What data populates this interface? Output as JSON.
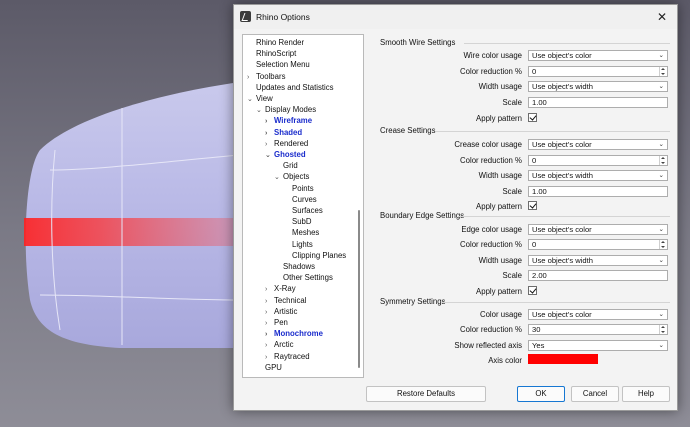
{
  "window": {
    "title": "Rhino Options",
    "close_glyph": "✕"
  },
  "tree": {
    "items": [
      {
        "label": "Rhino Render",
        "level": 0,
        "chev": "",
        "bold": false
      },
      {
        "label": "RhinoScript",
        "level": 0,
        "chev": "",
        "bold": false
      },
      {
        "label": "Selection Menu",
        "level": 0,
        "chev": "",
        "bold": false
      },
      {
        "label": "Toolbars",
        "level": 0,
        "chev": "›",
        "bold": false
      },
      {
        "label": "Updates and Statistics",
        "level": 0,
        "chev": "",
        "bold": false
      },
      {
        "label": "View",
        "level": 0,
        "chev": "⌄",
        "bold": false
      },
      {
        "label": "Display Modes",
        "level": 1,
        "chev": "⌄",
        "bold": false
      },
      {
        "label": "Wireframe",
        "level": 2,
        "chev": "›",
        "bold": true
      },
      {
        "label": "Shaded",
        "level": 2,
        "chev": "›",
        "bold": true
      },
      {
        "label": "Rendered",
        "level": 2,
        "chev": "›",
        "bold": false
      },
      {
        "label": "Ghosted",
        "level": 2,
        "chev": "⌄",
        "bold": true
      },
      {
        "label": "Grid",
        "level": 3,
        "chev": "",
        "bold": false
      },
      {
        "label": "Objects",
        "level": 3,
        "chev": "⌄",
        "bold": false
      },
      {
        "label": "Points",
        "level": 4,
        "chev": "",
        "bold": false
      },
      {
        "label": "Curves",
        "level": 4,
        "chev": "",
        "bold": false
      },
      {
        "label": "Surfaces",
        "level": 4,
        "chev": "",
        "bold": false
      },
      {
        "label": "SubD",
        "level": 4,
        "chev": "",
        "bold": false
      },
      {
        "label": "Meshes",
        "level": 4,
        "chev": "",
        "bold": false
      },
      {
        "label": "Lights",
        "level": 4,
        "chev": "",
        "bold": false
      },
      {
        "label": "Clipping Planes",
        "level": 4,
        "chev": "",
        "bold": false
      },
      {
        "label": "Shadows",
        "level": 3,
        "chev": "",
        "bold": false
      },
      {
        "label": "Other Settings",
        "level": 3,
        "chev": "",
        "bold": false
      },
      {
        "label": "X-Ray",
        "level": 2,
        "chev": "›",
        "bold": false
      },
      {
        "label": "Technical",
        "level": 2,
        "chev": "›",
        "bold": false
      },
      {
        "label": "Artistic",
        "level": 2,
        "chev": "›",
        "bold": false
      },
      {
        "label": "Pen",
        "level": 2,
        "chev": "›",
        "bold": false
      },
      {
        "label": "Monochrome",
        "level": 2,
        "chev": "›",
        "bold": true
      },
      {
        "label": "Arctic",
        "level": 2,
        "chev": "›",
        "bold": false
      },
      {
        "label": "Raytraced",
        "level": 2,
        "chev": "›",
        "bold": false
      },
      {
        "label": "GPU",
        "level": 1,
        "chev": "",
        "bold": false
      }
    ],
    "selected": "SubD"
  },
  "smooth_wire": {
    "title": "Smooth Wire Settings",
    "wire_color_usage": {
      "label": "Wire color usage",
      "value": "Use object's color"
    },
    "color_reduction": {
      "label": "Color reduction %",
      "value": "0"
    },
    "width_usage": {
      "label": "Width usage",
      "value": "Use object's width"
    },
    "scale": {
      "label": "Scale",
      "value": "1.00"
    },
    "apply_pattern": {
      "label": "Apply pattern",
      "checked": true
    }
  },
  "crease": {
    "title": "Crease Settings",
    "crease_color_usage": {
      "label": "Crease color usage",
      "value": "Use object's color"
    },
    "color_reduction": {
      "label": "Color reduction %",
      "value": "0"
    },
    "width_usage": {
      "label": "Width usage",
      "value": "Use object's width"
    },
    "scale": {
      "label": "Scale",
      "value": "1.00"
    },
    "apply_pattern": {
      "label": "Apply pattern",
      "checked": true
    }
  },
  "boundary": {
    "title": "Boundary Edge Settings",
    "edge_color_usage": {
      "label": "Edge color usage",
      "value": "Use object's color"
    },
    "color_reduction": {
      "label": "Color reduction %",
      "value": "0"
    },
    "width_usage": {
      "label": "Width usage",
      "value": "Use object's width"
    },
    "scale": {
      "label": "Scale",
      "value": "2.00"
    },
    "apply_pattern": {
      "label": "Apply pattern",
      "checked": true
    }
  },
  "symmetry": {
    "title": "Symmetry Settings",
    "color_usage": {
      "label": "Color usage",
      "value": "Use object's color"
    },
    "color_reduction": {
      "label": "Color reduction %",
      "value": "30"
    },
    "show_reflected_axis": {
      "label": "Show reflected axis",
      "value": "Yes"
    },
    "axis_color": {
      "label": "Axis color",
      "color": "#ff0000"
    }
  },
  "buttons": {
    "restore": "Restore Defaults",
    "ok": "OK",
    "cancel": "Cancel",
    "help": "Help"
  }
}
